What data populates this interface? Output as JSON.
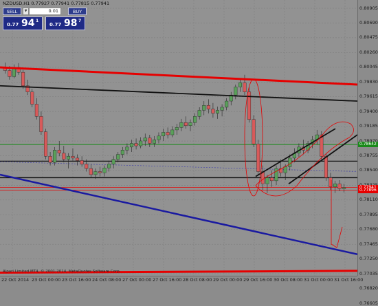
{
  "window": {
    "symbol_title": "NZDUSD,H1  0.77927 0.77941 0.77815 0.77941",
    "copyright": "Alpari Limited MT4, © 2001-2014, MetaQuotes Software Corp."
  },
  "trade_panel": {
    "sell_label": "SELL",
    "buy_label": "BUY",
    "lot_value": "0.01",
    "lot_arrow": "▼",
    "bid_prefix": "0.77",
    "bid_big": "94",
    "bid_sup": "1",
    "ask_prefix": "0.77",
    "ask_big": "98",
    "ask_sup": "7"
  },
  "axis": {
    "price_ticks": [
      "0.80905",
      "0.80690",
      "0.80475",
      "0.80260",
      "0.80045",
      "0.79830",
      "0.79615",
      "0.79400",
      "0.79185",
      "0.78970",
      "0.78755",
      "0.78540",
      "0.78325",
      "0.78110",
      "0.77895",
      "0.77680",
      "0.77465",
      "0.77250",
      "0.77035",
      "0.76820",
      "0.76605"
    ],
    "time_ticks": [
      "22 Oct 2014",
      "23 Oct 00:00",
      "23 Oct 16:00",
      "24 Oct 08:00",
      "27 Oct 00:00",
      "27 Oct 16:00",
      "28 Oct 08:00",
      "29 Oct 00:00",
      "29 Oct 16:00",
      "30 Oct 08:00",
      "31 Oct 00:00",
      "31 Oct 16:00"
    ],
    "badge_green": "0.78642",
    "badge_red_1": "0.77941",
    "badge_red_2": "0.77896"
  },
  "colors": {
    "background": "#929292",
    "grid": "#7a7a7a",
    "candle_up": "#5aa05a",
    "candle_down": "#d85a5a",
    "support_red": "#e60000",
    "trend_black": "#111111",
    "trend_blue": "#1a1aa0",
    "horizontal_green": "#1a8a1a",
    "panel_blue": "#1f2a86"
  },
  "icons": {
    "lot_dropdown": "chevron-down-icon"
  },
  "chart_data": {
    "type": "candlestick",
    "symbol": "NZDUSD",
    "timeframe": "H1",
    "ylim": [
      0.765,
      0.81
    ],
    "levels": {
      "green_line": 0.78642,
      "bid_line": 0.77941,
      "red_line": 0.77896,
      "black_horizontal": 0.781,
      "black_horizontal_2": 0.7837
    },
    "candles": [
      [
        0.799,
        0.7998,
        0.798,
        0.7985
      ],
      [
        0.7985,
        0.7992,
        0.797,
        0.7975
      ],
      [
        0.7975,
        0.7995,
        0.7972,
        0.799
      ],
      [
        0.799,
        0.7997,
        0.7978,
        0.7982
      ],
      [
        0.7982,
        0.7986,
        0.7955,
        0.796
      ],
      [
        0.796,
        0.797,
        0.7945,
        0.795
      ],
      [
        0.795,
        0.7955,
        0.7925,
        0.793
      ],
      [
        0.793,
        0.794,
        0.7905,
        0.791
      ],
      [
        0.791,
        0.7918,
        0.788,
        0.7885
      ],
      [
        0.7885,
        0.789,
        0.784,
        0.7845
      ],
      [
        0.7845,
        0.7852,
        0.783,
        0.7835
      ],
      [
        0.7835,
        0.786,
        0.783,
        0.7855
      ],
      [
        0.7855,
        0.787,
        0.7845,
        0.785
      ],
      [
        0.785,
        0.7862,
        0.7835,
        0.784
      ],
      [
        0.784,
        0.785,
        0.7825,
        0.7845
      ],
      [
        0.7845,
        0.7858,
        0.7838,
        0.7842
      ],
      [
        0.7842,
        0.7848,
        0.783,
        0.7838
      ],
      [
        0.7838,
        0.7845,
        0.7828,
        0.7832
      ],
      [
        0.7832,
        0.784,
        0.782,
        0.7825
      ],
      [
        0.7825,
        0.7832,
        0.781,
        0.7815
      ],
      [
        0.7815,
        0.7825,
        0.7808,
        0.782
      ],
      [
        0.782,
        0.7828,
        0.7812,
        0.7818
      ],
      [
        0.7818,
        0.783,
        0.7812,
        0.7826
      ],
      [
        0.7826,
        0.7838,
        0.782,
        0.7832
      ],
      [
        0.7832,
        0.7845,
        0.7825,
        0.784
      ],
      [
        0.784,
        0.7852,
        0.7835,
        0.7848
      ],
      [
        0.7848,
        0.786,
        0.7842,
        0.7855
      ],
      [
        0.7855,
        0.7866,
        0.7848,
        0.786
      ],
      [
        0.786,
        0.7872,
        0.7852,
        0.7866
      ],
      [
        0.7866,
        0.7874,
        0.7856,
        0.7862
      ],
      [
        0.7862,
        0.7876,
        0.7858,
        0.787
      ],
      [
        0.787,
        0.7882,
        0.7862,
        0.7875
      ],
      [
        0.7875,
        0.788,
        0.786,
        0.7866
      ],
      [
        0.7866,
        0.7878,
        0.786,
        0.7872
      ],
      [
        0.7872,
        0.7884,
        0.7866,
        0.7878
      ],
      [
        0.7878,
        0.789,
        0.787,
        0.7884
      ],
      [
        0.7884,
        0.7892,
        0.7874,
        0.788
      ],
      [
        0.788,
        0.7894,
        0.7876,
        0.7888
      ],
      [
        0.7888,
        0.7898,
        0.788,
        0.7892
      ],
      [
        0.7892,
        0.7906,
        0.7886,
        0.79
      ],
      [
        0.79,
        0.791,
        0.789,
        0.7895
      ],
      [
        0.7895,
        0.7905,
        0.7886,
        0.79
      ],
      [
        0.79,
        0.7915,
        0.7895,
        0.791
      ],
      [
        0.791,
        0.7925,
        0.7905,
        0.792
      ],
      [
        0.792,
        0.7935,
        0.7912,
        0.7928
      ],
      [
        0.7928,
        0.7938,
        0.7915,
        0.7922
      ],
      [
        0.7922,
        0.7932,
        0.7908,
        0.7915
      ],
      [
        0.7915,
        0.7926,
        0.7906,
        0.792
      ],
      [
        0.792,
        0.793,
        0.791,
        0.7925
      ],
      [
        0.7925,
        0.794,
        0.792,
        0.7935
      ],
      [
        0.7935,
        0.795,
        0.7928,
        0.7945
      ],
      [
        0.7945,
        0.7962,
        0.7938,
        0.7958
      ],
      [
        0.7958,
        0.7972,
        0.795,
        0.7965
      ],
      [
        0.7965,
        0.7978,
        0.7945,
        0.795
      ],
      [
        0.795,
        0.7958,
        0.79,
        0.7905
      ],
      [
        0.7905,
        0.7912,
        0.786,
        0.7865
      ],
      [
        0.7865,
        0.7872,
        0.7815,
        0.782
      ],
      [
        0.782,
        0.783,
        0.779,
        0.78
      ],
      [
        0.78,
        0.7815,
        0.7785,
        0.781
      ],
      [
        0.781,
        0.7822,
        0.7795,
        0.7805
      ],
      [
        0.7805,
        0.783,
        0.7798,
        0.7825
      ],
      [
        0.7825,
        0.784,
        0.7812,
        0.7818
      ],
      [
        0.7818,
        0.7832,
        0.7806,
        0.7828
      ],
      [
        0.7828,
        0.7848,
        0.7822,
        0.7842
      ],
      [
        0.7842,
        0.7858,
        0.7835,
        0.785
      ],
      [
        0.785,
        0.7866,
        0.7844,
        0.786
      ],
      [
        0.786,
        0.7872,
        0.7848,
        0.7855
      ],
      [
        0.7855,
        0.787,
        0.785,
        0.7866
      ],
      [
        0.7866,
        0.7878,
        0.7858,
        0.7872
      ],
      [
        0.7872,
        0.7888,
        0.7864,
        0.788
      ],
      [
        0.788,
        0.7886,
        0.784,
        0.7845
      ],
      [
        0.7845,
        0.785,
        0.7805,
        0.781
      ],
      [
        0.781,
        0.7818,
        0.779,
        0.7795
      ],
      [
        0.7795,
        0.7805,
        0.7785,
        0.78
      ],
      [
        0.78,
        0.7806,
        0.7788,
        0.7792
      ],
      [
        0.7792,
        0.78,
        0.7786,
        0.7794
      ]
    ],
    "trendlines": [
      {
        "name": "upper-red-resistance",
        "color": "red",
        "points": [
          [
            "22 Oct",
            0.799
          ],
          [
            "31 Oct",
            0.7962
          ]
        ]
      },
      {
        "name": "lower-red-support",
        "color": "red",
        "points": [
          [
            "22 Oct",
            0.7655
          ],
          [
            "31 Oct",
            0.7658
          ]
        ]
      },
      {
        "name": "upper-black-trend",
        "color": "black",
        "points": [
          [
            "22 Oct",
            0.796
          ],
          [
            "31 Oct",
            0.7935
          ]
        ]
      },
      {
        "name": "blue-downtrend",
        "color": "blue",
        "points": [
          [
            "22 Oct",
            0.7815
          ],
          [
            "31 Oct",
            0.7685
          ]
        ]
      },
      {
        "name": "channel-upper",
        "color": "black",
        "points": [
          [
            "29 Oct 16:00",
            0.7812
          ],
          [
            "31 Oct 00:00",
            0.789
          ]
        ]
      },
      {
        "name": "channel-lower",
        "color": "black",
        "points": [
          [
            "30 Oct 08:00",
            0.78
          ],
          [
            "31 Oct 16:00",
            0.788
          ]
        ]
      }
    ]
  }
}
